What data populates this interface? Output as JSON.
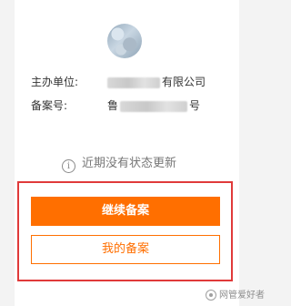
{
  "record": {
    "company_label": "主办单位:",
    "company_value_visible": "有限公司",
    "record_no_label": "备案号:",
    "record_no_prefix_visible": "鲁",
    "record_no_suffix_visible": "号"
  },
  "status": {
    "text": "近期没有状态更新",
    "icon_glyph": "i"
  },
  "actions": {
    "continue_label": "继续备案",
    "my_records_label": "我的备案"
  },
  "watermark": {
    "text": "网管爱好者"
  },
  "colors": {
    "accent": "#ff6f00",
    "highlight_border": "#e03a3a",
    "background": "#f3f3f3",
    "card": "#ffffff"
  }
}
